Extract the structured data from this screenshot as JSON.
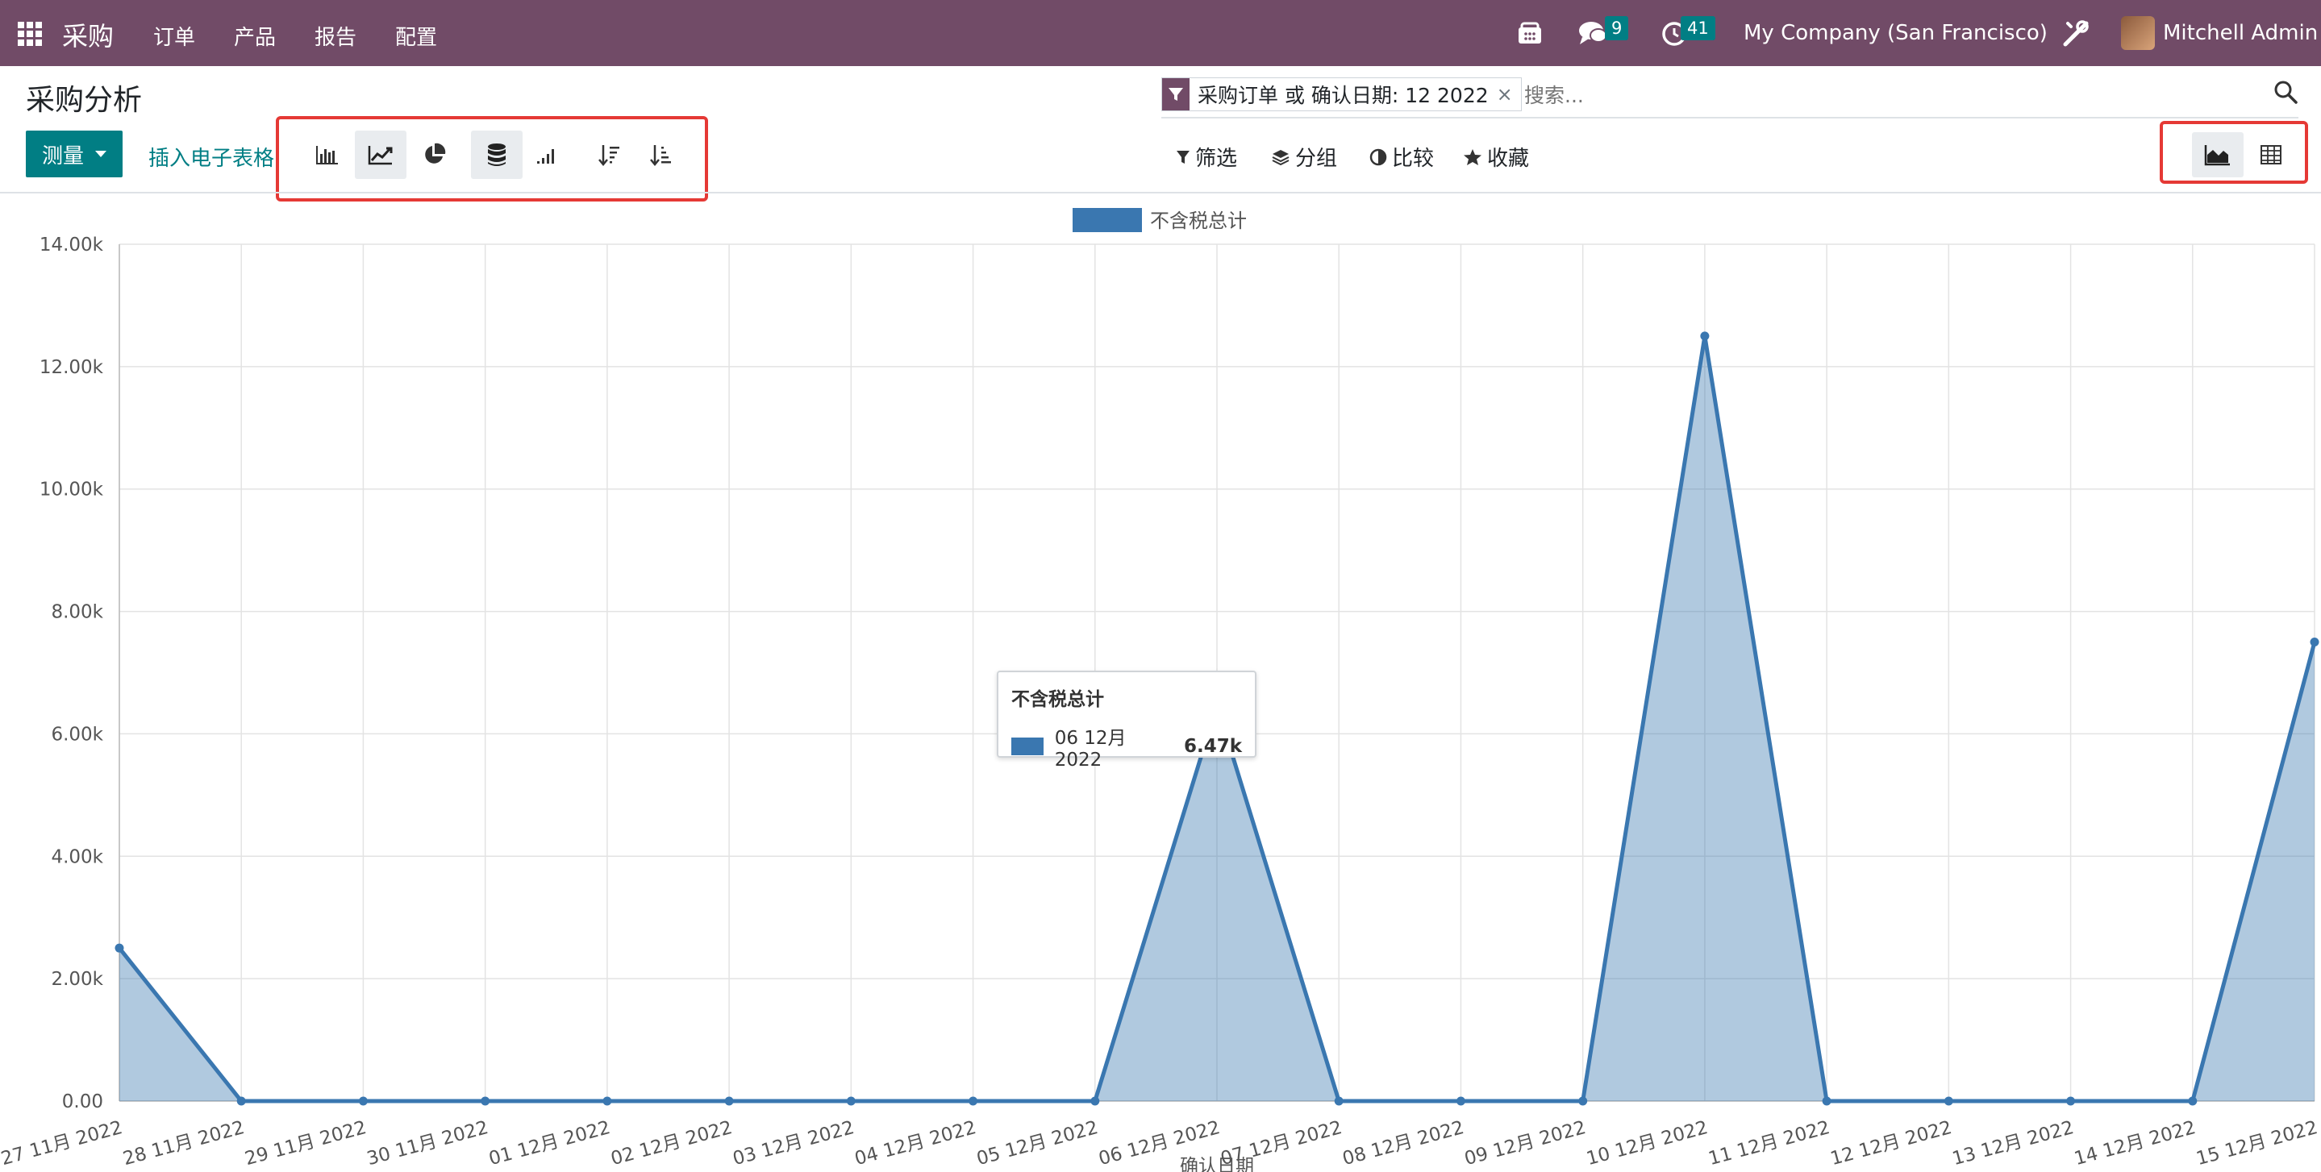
{
  "navbar": {
    "app_name": "采购",
    "menu": [
      "订单",
      "产品",
      "报告",
      "配置"
    ],
    "messages_count": "9",
    "activities_count": "41",
    "company": "My Company (San Francisco)",
    "user": "Mitchell Admin"
  },
  "control_panel": {
    "title": "采购分析",
    "facet_text": "采购订单 或 确认日期: 12 2022",
    "facet_close": "×",
    "search_placeholder": "搜索...",
    "measure_label": "测量",
    "insert_sheet_label": "插入电子表格",
    "filters_label": "筛选",
    "group_label": "分组",
    "compare_label": "比较",
    "favorites_label": "收藏"
  },
  "colors": {
    "navbar": "#714B67",
    "primary": "#017e84",
    "series": "#3a77b0",
    "highlight": "#e53935"
  },
  "chart_data": {
    "type": "area",
    "legend": [
      "不含税总计"
    ],
    "xlabel": "确认日期",
    "ylabel": "",
    "ylim": [
      0,
      14000
    ],
    "yticks": [
      "0.00",
      "2.00k",
      "4.00k",
      "6.00k",
      "8.00k",
      "10.00k",
      "12.00k",
      "14.00k"
    ],
    "categories": [
      "27 11月 2022",
      "28 11月 2022",
      "29 11月 2022",
      "30 11月 2022",
      "01 12月 2022",
      "02 12月 2022",
      "03 12月 2022",
      "04 12月 2022",
      "05 12月 2022",
      "06 12月 2022",
      "07 12月 2022",
      "08 12月 2022",
      "09 12月 2022",
      "10 12月 2022",
      "11 12月 2022",
      "12 12月 2022",
      "13 12月 2022",
      "14 12月 2022",
      "15 12月 2022"
    ],
    "series": [
      {
        "name": "不含税总计",
        "values": [
          2500,
          0,
          0,
          0,
          0,
          0,
          0,
          0,
          0,
          6470,
          0,
          0,
          0,
          12500,
          0,
          0,
          0,
          0,
          7500
        ]
      }
    ],
    "grid": true,
    "legend_position": "top-center",
    "tooltip": {
      "title": "不含税总计",
      "label": "06 12月 2022",
      "value": "6.47k"
    }
  }
}
